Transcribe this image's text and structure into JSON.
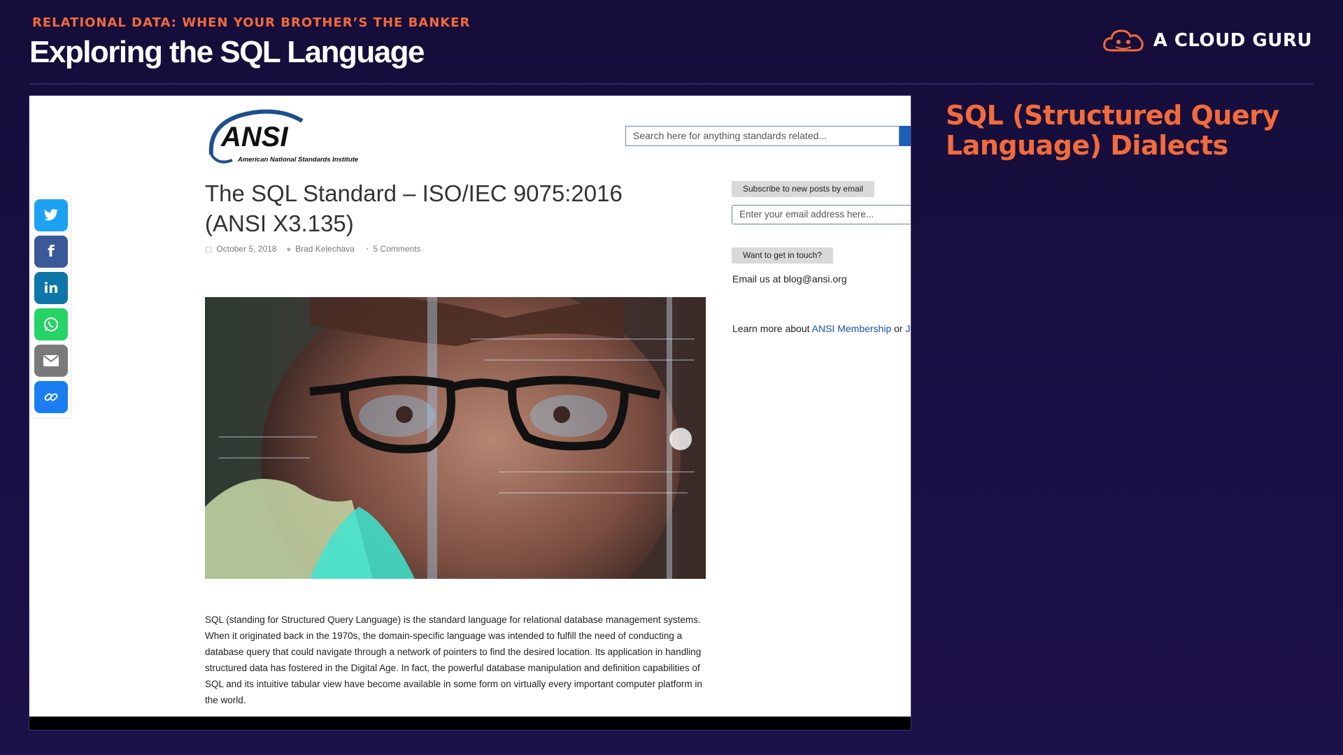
{
  "slide": {
    "kicker": "RELATIONAL DATA: WHEN YOUR BROTHER’S THE BANKER",
    "title": "Exploring the SQL Language",
    "brand": "A CLOUD GURU",
    "heading": "SQL (Structured Query Language) Dialects"
  },
  "webpage": {
    "logo_text": "ANSI",
    "logo_subtitle": "American National Standards Institute",
    "search_placeholder": "Search here for anything standards related...",
    "share_buttons": [
      {
        "name": "twitter-icon",
        "color": "#1da1f2"
      },
      {
        "name": "facebook-icon",
        "color": "#3b5998"
      },
      {
        "name": "linkedin-icon",
        "color": "#0e76a8"
      },
      {
        "name": "whatsapp-icon",
        "color": "#25d366"
      },
      {
        "name": "email-icon",
        "color": "#7a7a7a"
      },
      {
        "name": "link-icon",
        "color": "#1a7ef2"
      }
    ],
    "post": {
      "title": "The SQL Standard – ISO/IEC 9075:2016 (ANSI X3.135)",
      "date": "October 5, 2018",
      "author": "Brad Kelechava",
      "comments": "5 Comments",
      "body": "SQL (standing for Structured Query Language) is the standard language for relational database management systems. When it originated back in the 1970s, the domain-specific language was intended to fulfill the need of conducting a database query that could navigate through a network of pointers to find the desired location. Its application in handling structured data has fostered in the Digital Age. In fact, the powerful database manipulation and definition capabilities of SQL and its intuitive tabular view have become available in some form on virtually every important computer platform in the world."
    },
    "sidebar": {
      "subscribe_label": "Subscribe to new posts by email",
      "email_placeholder": "Enter your email address here...",
      "contact_label": "Want to get in touch?",
      "email_text": "Email us at blog@ansi.org",
      "learn_more_prefix": "Learn more about ",
      "membership_link": "ANSI Membership",
      "or_text": " or ",
      "join_link": "Jo"
    }
  },
  "colors": {
    "accent": "#f26b3a",
    "background": "#150d3a"
  }
}
